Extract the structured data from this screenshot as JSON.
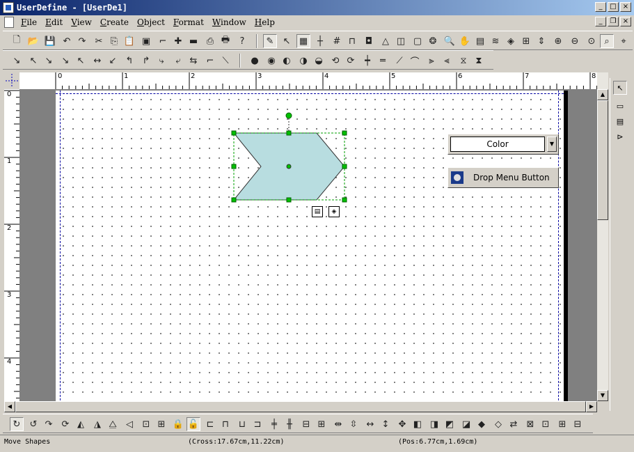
{
  "window": {
    "title": "UserDefine - [UserDe1]",
    "min": "_",
    "max": "□",
    "close": "×",
    "restore": "❐"
  },
  "menu": [
    "File",
    "Edit",
    "View",
    "Create",
    "Object",
    "Format",
    "Window",
    "Help"
  ],
  "canvas": {
    "combo_label": "Color",
    "drop_button_label": "Drop Menu Button",
    "ruler_top": [
      "0",
      "1",
      "2",
      "3",
      "4",
      "5",
      "6",
      "7",
      "8"
    ],
    "ruler_left": [
      "0",
      "1",
      "2",
      "3",
      "4"
    ],
    "shape_fill": "#b8dde0",
    "handle_color": "#00b000"
  },
  "status": {
    "message": "Move Shapes",
    "cross": "(Cross:17.67cm,11.22cm)",
    "pos": "(Pos:6.77cm,1.69cm)"
  }
}
